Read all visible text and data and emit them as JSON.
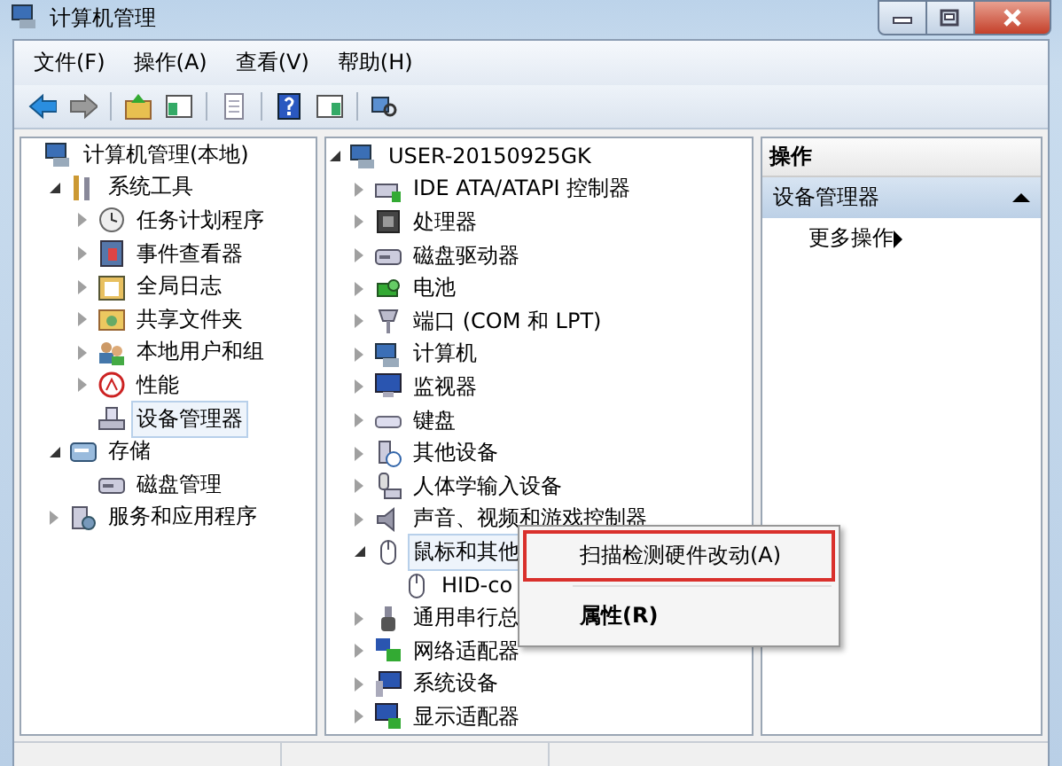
{
  "window": {
    "title": "计算机管理"
  },
  "menu": [
    "文件(F)",
    "操作(A)",
    "查看(V)",
    "帮助(H)"
  ],
  "left_tree": [
    {
      "label": "计算机管理(本地)",
      "selected": false,
      "children": [
        {
          "label": "系统工具",
          "expanded": true,
          "selected": false,
          "children": [
            {
              "label": "任务计划程序",
              "expanded": false,
              "selected": false
            },
            {
              "label": "事件查看器",
              "expanded": false,
              "selected": false
            },
            {
              "label": "全局日志",
              "expanded": false,
              "selected": false
            },
            {
              "label": "共享文件夹",
              "expanded": false,
              "selected": false
            },
            {
              "label": "本地用户和组",
              "expanded": false,
              "selected": false
            },
            {
              "label": "性能",
              "expanded": false,
              "selected": false
            },
            {
              "label": "设备管理器",
              "selected": true
            }
          ]
        },
        {
          "label": "存储",
          "expanded": true,
          "selected": false,
          "children": [
            {
              "label": "磁盘管理",
              "selected": false
            }
          ]
        },
        {
          "label": "服务和应用程序",
          "expanded": false,
          "selected": false
        }
      ]
    }
  ],
  "device_tree": [
    {
      "label": "USER-20150925GK",
      "expanded": true,
      "selected": false,
      "children": [
        {
          "label": "IDE ATA/ATAPI 控制器",
          "expanded": false,
          "selected": false
        },
        {
          "label": "处理器",
          "expanded": false,
          "selected": false
        },
        {
          "label": "磁盘驱动器",
          "expanded": false,
          "selected": false
        },
        {
          "label": "电池",
          "expanded": false,
          "selected": false
        },
        {
          "label": "端口 (COM 和 LPT)",
          "expanded": false,
          "selected": false
        },
        {
          "label": "计算机",
          "expanded": false,
          "selected": false
        },
        {
          "label": "监视器",
          "expanded": false,
          "selected": false
        },
        {
          "label": "键盘",
          "expanded": false,
          "selected": false
        },
        {
          "label": "其他设备",
          "expanded": false,
          "selected": false
        },
        {
          "label": "人体学输入设备",
          "expanded": false,
          "selected": false
        },
        {
          "label": "声音、视频和游戏控制器",
          "expanded": false,
          "selected": false
        },
        {
          "label": "鼠标和其他",
          "expanded": true,
          "selected": true,
          "children": [
            {
              "label": "HID-co",
              "selected": false
            }
          ]
        },
        {
          "label": "通用串行总",
          "expanded": false,
          "selected": false
        },
        {
          "label": "网络适配器",
          "expanded": false,
          "selected": false
        },
        {
          "label": "系统设备",
          "expanded": false,
          "selected": false
        },
        {
          "label": "显示适配器",
          "expanded": false,
          "selected": false
        }
      ]
    }
  ],
  "actions": {
    "header": "操作",
    "section": {
      "label": "设备管理器",
      "expanded": true
    },
    "items": [
      {
        "label": "更多操作"
      }
    ]
  },
  "context_menu": [
    {
      "label": "扫描检测硬件改动(A)",
      "highlighted": true,
      "bold": false
    },
    {
      "label": "属性(R)",
      "highlighted": false,
      "bold": true
    }
  ]
}
